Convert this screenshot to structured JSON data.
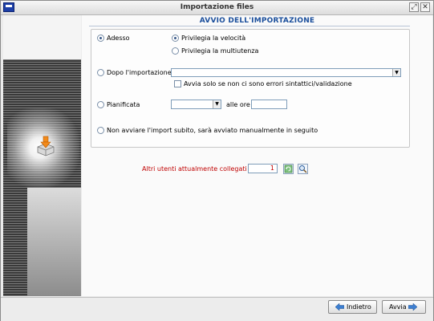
{
  "window": {
    "title": "Importazione files"
  },
  "section": {
    "title": "AVVIO DELL'IMPORTAZIONE"
  },
  "options": {
    "adesso": {
      "label": "Adesso",
      "selected": true
    },
    "privilegia_velocita": {
      "label": "Privilegia la velocità",
      "selected": true
    },
    "privilegia_multiutenza": {
      "label": "Privilegia la multiutenza",
      "selected": false
    },
    "dopo_importazione": {
      "label": "Dopo l'importazione",
      "selected": false,
      "combo_value": ""
    },
    "avvia_solo_se": {
      "label": "Avvia solo se non ci sono errori sintattici/validazione",
      "checked": false
    },
    "pianificata": {
      "label": "Pianificata",
      "selected": false,
      "date_value": "",
      "time_label": "alle ore",
      "time_value": ""
    },
    "non_avviare": {
      "label": "Non avviare l'import subito, sarà avviato manualmente in seguito",
      "selected": false
    }
  },
  "users": {
    "label": "Altri utenti attualmente collegati",
    "count": "1"
  },
  "buttons": {
    "back": "Indietro",
    "next": "Avvia"
  },
  "icons": [
    "app-icon",
    "restore-icon",
    "close-icon",
    "import-box-icon",
    "refresh-icon",
    "search-icon",
    "arrow-left-icon",
    "arrow-right-icon"
  ],
  "colors": {
    "accent_title": "#1b4f9c",
    "users_red": "#c00000"
  }
}
